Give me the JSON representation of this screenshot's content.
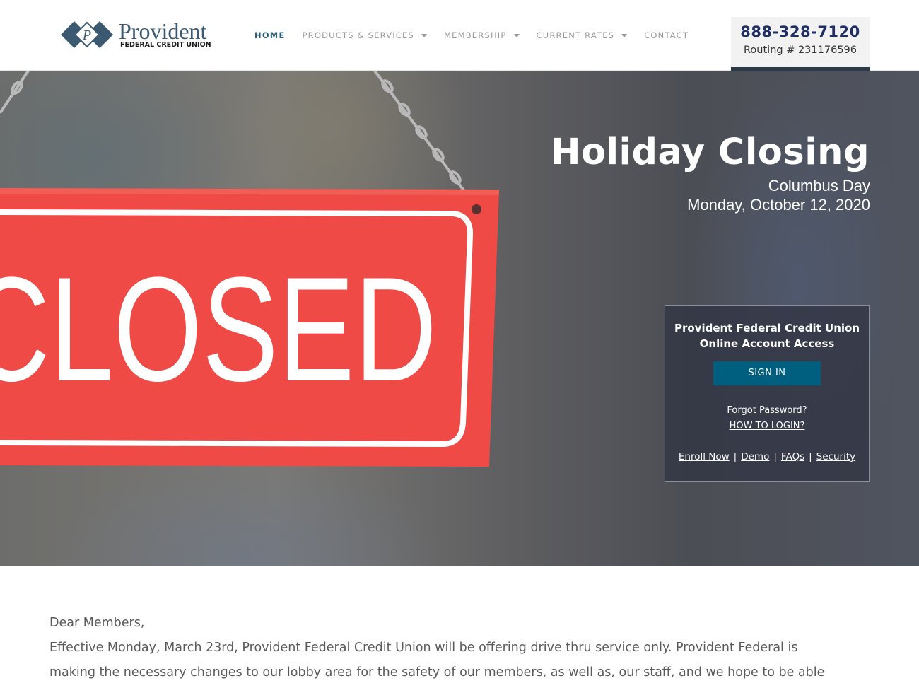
{
  "brand": {
    "name": "Provident",
    "subtitle": "FEDERAL CREDIT UNION",
    "logo_letter": "P"
  },
  "nav": {
    "items": [
      {
        "label": "HOME",
        "active": true,
        "has_dropdown": false
      },
      {
        "label": "PRODUCTS & SERVICES",
        "active": false,
        "has_dropdown": true
      },
      {
        "label": "MEMBERSHIP",
        "active": false,
        "has_dropdown": true
      },
      {
        "label": "CURRENT RATES",
        "active": false,
        "has_dropdown": true
      },
      {
        "label": "CONTACT",
        "active": false,
        "has_dropdown": false
      }
    ]
  },
  "contact": {
    "phone": "888-328-7120",
    "routing": "Routing # 231176596"
  },
  "hero": {
    "sign_text": "CLOSED",
    "title": "Holiday Closing",
    "subtitle": "Columbus Day",
    "date": "Monday, October 12, 2020"
  },
  "login": {
    "title_line1": "Provident Federal Credit Union",
    "title_line2": "Online Account Access",
    "signin_label": "SIGN IN",
    "forgot_label": "Forgot Password?",
    "howto_label": "HOW TO LOGIN?",
    "links": [
      "Enroll Now",
      "Demo",
      "FAQs",
      "Security"
    ],
    "separator": "|"
  },
  "content": {
    "greeting": "Dear Members,",
    "line1": "Effective Monday, March 23rd, Provident Federal Credit Union will be offering drive thru service only.  Provident Federal is",
    "line2": "making the necessary changes to our lobby area for the safety of our members, as well as, our staff, and we hope to be able"
  },
  "colors": {
    "nav_active": "#2b5d7a",
    "phone": "#1f2f66",
    "signin_button": "#005f7f",
    "sign_red": "#ef4a45",
    "logo_blue": "#3b5a72"
  }
}
